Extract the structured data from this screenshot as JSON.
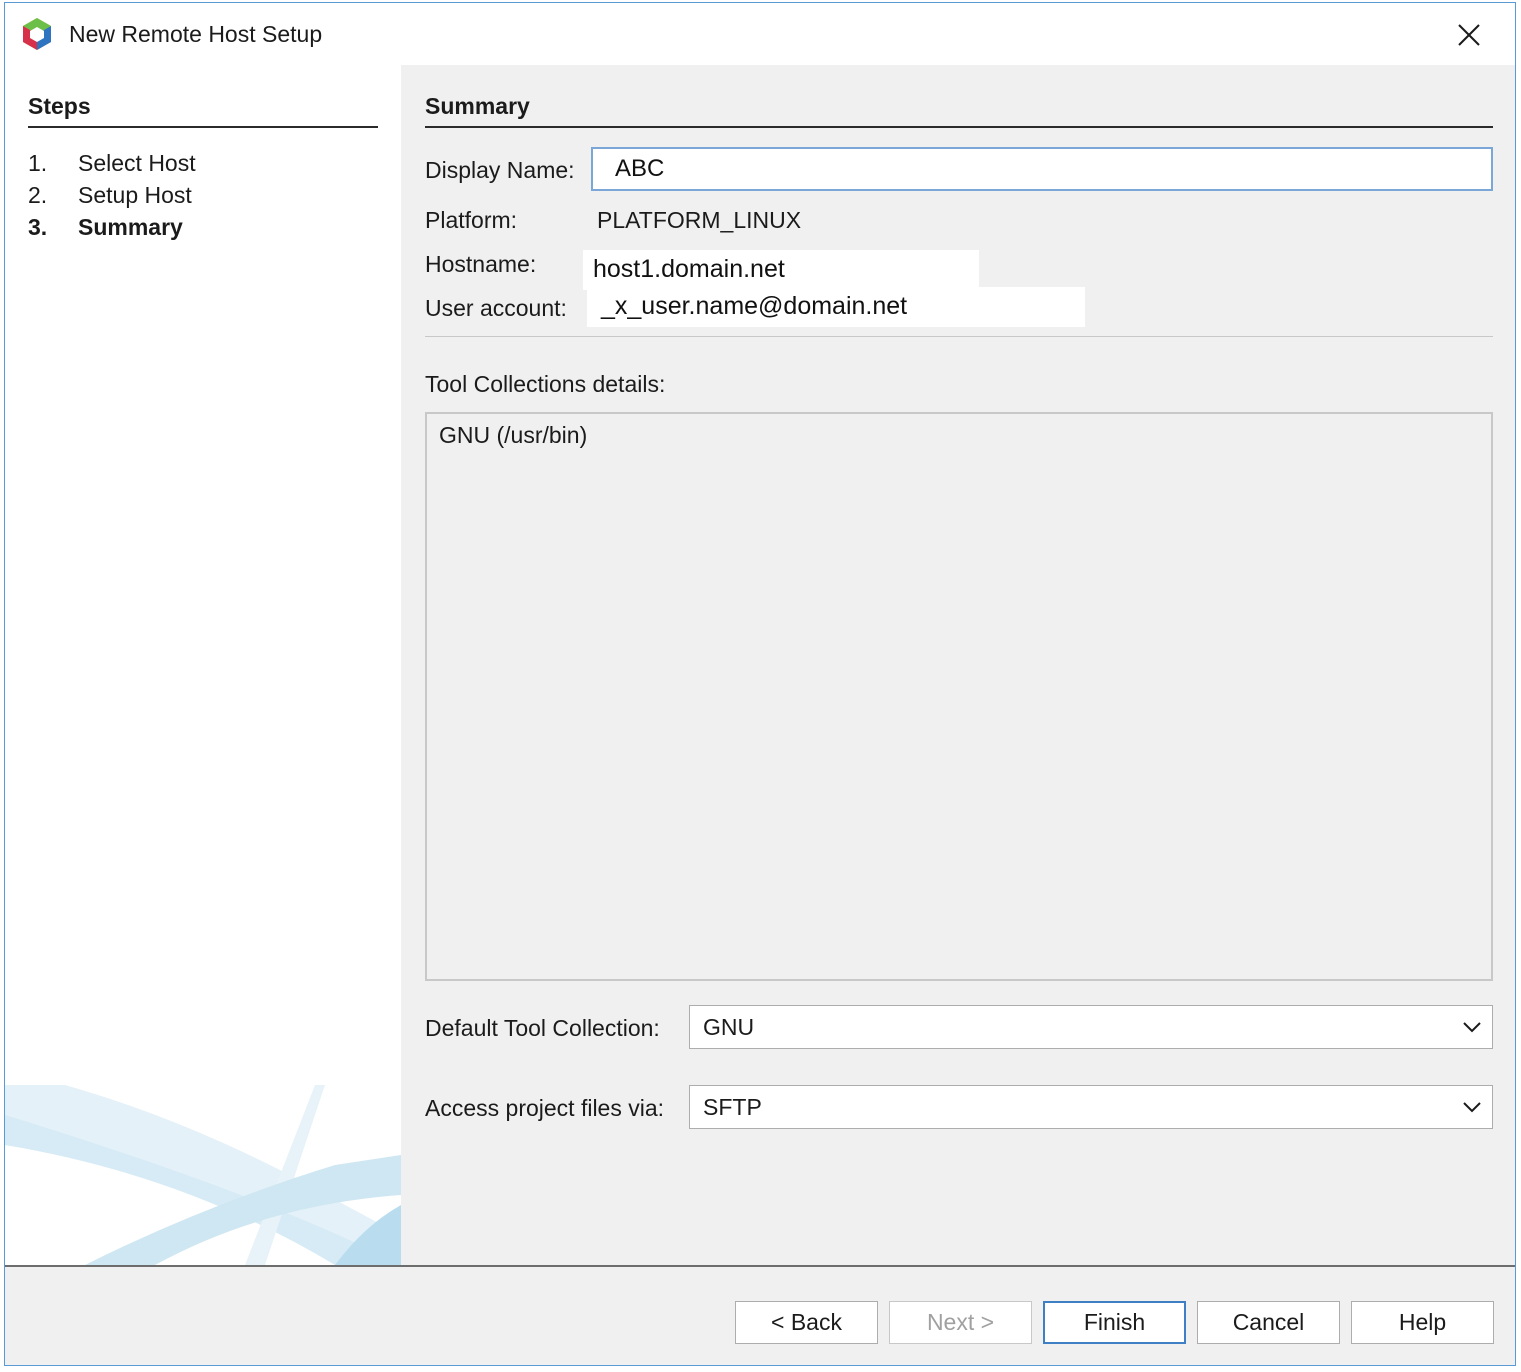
{
  "window": {
    "title": "New Remote Host Setup",
    "app_icon": "netbeans-cube-icon",
    "close_icon": "close-icon"
  },
  "steps": {
    "heading": "Steps",
    "items": [
      {
        "num": "1.",
        "label": "Select Host",
        "active": false
      },
      {
        "num": "2.",
        "label": "Setup Host",
        "active": false
      },
      {
        "num": "3.",
        "label": "Summary",
        "active": true
      }
    ]
  },
  "summary": {
    "heading": "Summary",
    "display_name_label": "Display Name:",
    "display_name_value": "ABC",
    "platform_label": "Platform:",
    "platform_value": "PLATFORM_LINUX",
    "hostname_label": "Hostname:",
    "hostname_value": "host1.domain.net",
    "user_account_label": "User account:",
    "user_account_value": "_x_user.name@domain.net",
    "tool_collections_label": "Tool Collections details:",
    "tool_collections_text": "GNU (/usr/bin)",
    "default_tool_label": "Default Tool Collection:",
    "default_tool_value": "GNU",
    "access_label": "Access project files via:",
    "access_value": "SFTP"
  },
  "buttons": {
    "back": "< Back",
    "next": "Next >",
    "finish": "Finish",
    "cancel": "Cancel",
    "help": "Help"
  },
  "colors": {
    "window_border": "#5b9bd5",
    "focus_border": "#3f7fc4",
    "panel_background": "#f0f0f0"
  }
}
